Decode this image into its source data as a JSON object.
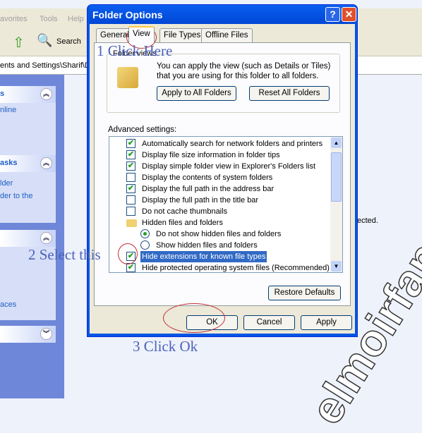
{
  "explorer": {
    "menu": [
      "avorites",
      "Tools",
      "Help"
    ],
    "toolbar": {
      "search_label": "Search"
    },
    "address": "ents and Settings\\Sharif\\D",
    "panels": [
      {
        "title": "s",
        "items": [
          "nline"
        ]
      },
      {
        "title": "asks",
        "items": [
          "lder",
          "der to the"
        ]
      },
      {
        "title": "",
        "items": [
          "aces"
        ]
      },
      {
        "title": "",
        "items": []
      }
    ],
    "content_text": "ected."
  },
  "dialog": {
    "title": "Folder Options",
    "tabs": [
      "General",
      "View",
      "File Types",
      "Offline Files"
    ],
    "active_tab": "View",
    "folder_views": {
      "legend": "Folder views",
      "description": "You can apply the view (such as Details or Tiles) that you are using for this folder to all folders.",
      "apply_all": "Apply to All Folders",
      "reset_all": "Reset All Folders"
    },
    "advanced_label": "Advanced settings:",
    "settings": [
      {
        "type": "checkbox",
        "label": "Automatically search for network folders and printers",
        "checked": true
      },
      {
        "type": "checkbox",
        "label": "Display file size information in folder tips",
        "checked": true
      },
      {
        "type": "checkbox",
        "label": "Display simple folder view in Explorer's Folders list",
        "checked": true
      },
      {
        "type": "checkbox",
        "label": "Display the contents of system folders",
        "checked": false
      },
      {
        "type": "checkbox",
        "label": "Display the full path in the address bar",
        "checked": true
      },
      {
        "type": "checkbox",
        "label": "Display the full path in the title bar",
        "checked": false
      },
      {
        "type": "checkbox",
        "label": "Do not cache thumbnails",
        "checked": false
      },
      {
        "type": "folder",
        "label": "Hidden files and folders"
      },
      {
        "type": "radio",
        "label": "Do not show hidden files and folders",
        "checked": true
      },
      {
        "type": "radio",
        "label": "Show hidden files and folders",
        "checked": false
      },
      {
        "type": "checkbox",
        "label": "Hide extensions for known file types",
        "checked": true,
        "selected": true
      },
      {
        "type": "checkbox",
        "label": "Hide protected operating system files (Recommended)",
        "checked": true
      }
    ],
    "restore_defaults": "Restore Defaults",
    "ok": "OK",
    "cancel": "Cancel",
    "apply": "Apply"
  },
  "annotations": {
    "step1": "1 Click Here",
    "step2": "2 Select this",
    "step3": "3 Click Ok"
  },
  "watermark": "elmoirfan"
}
